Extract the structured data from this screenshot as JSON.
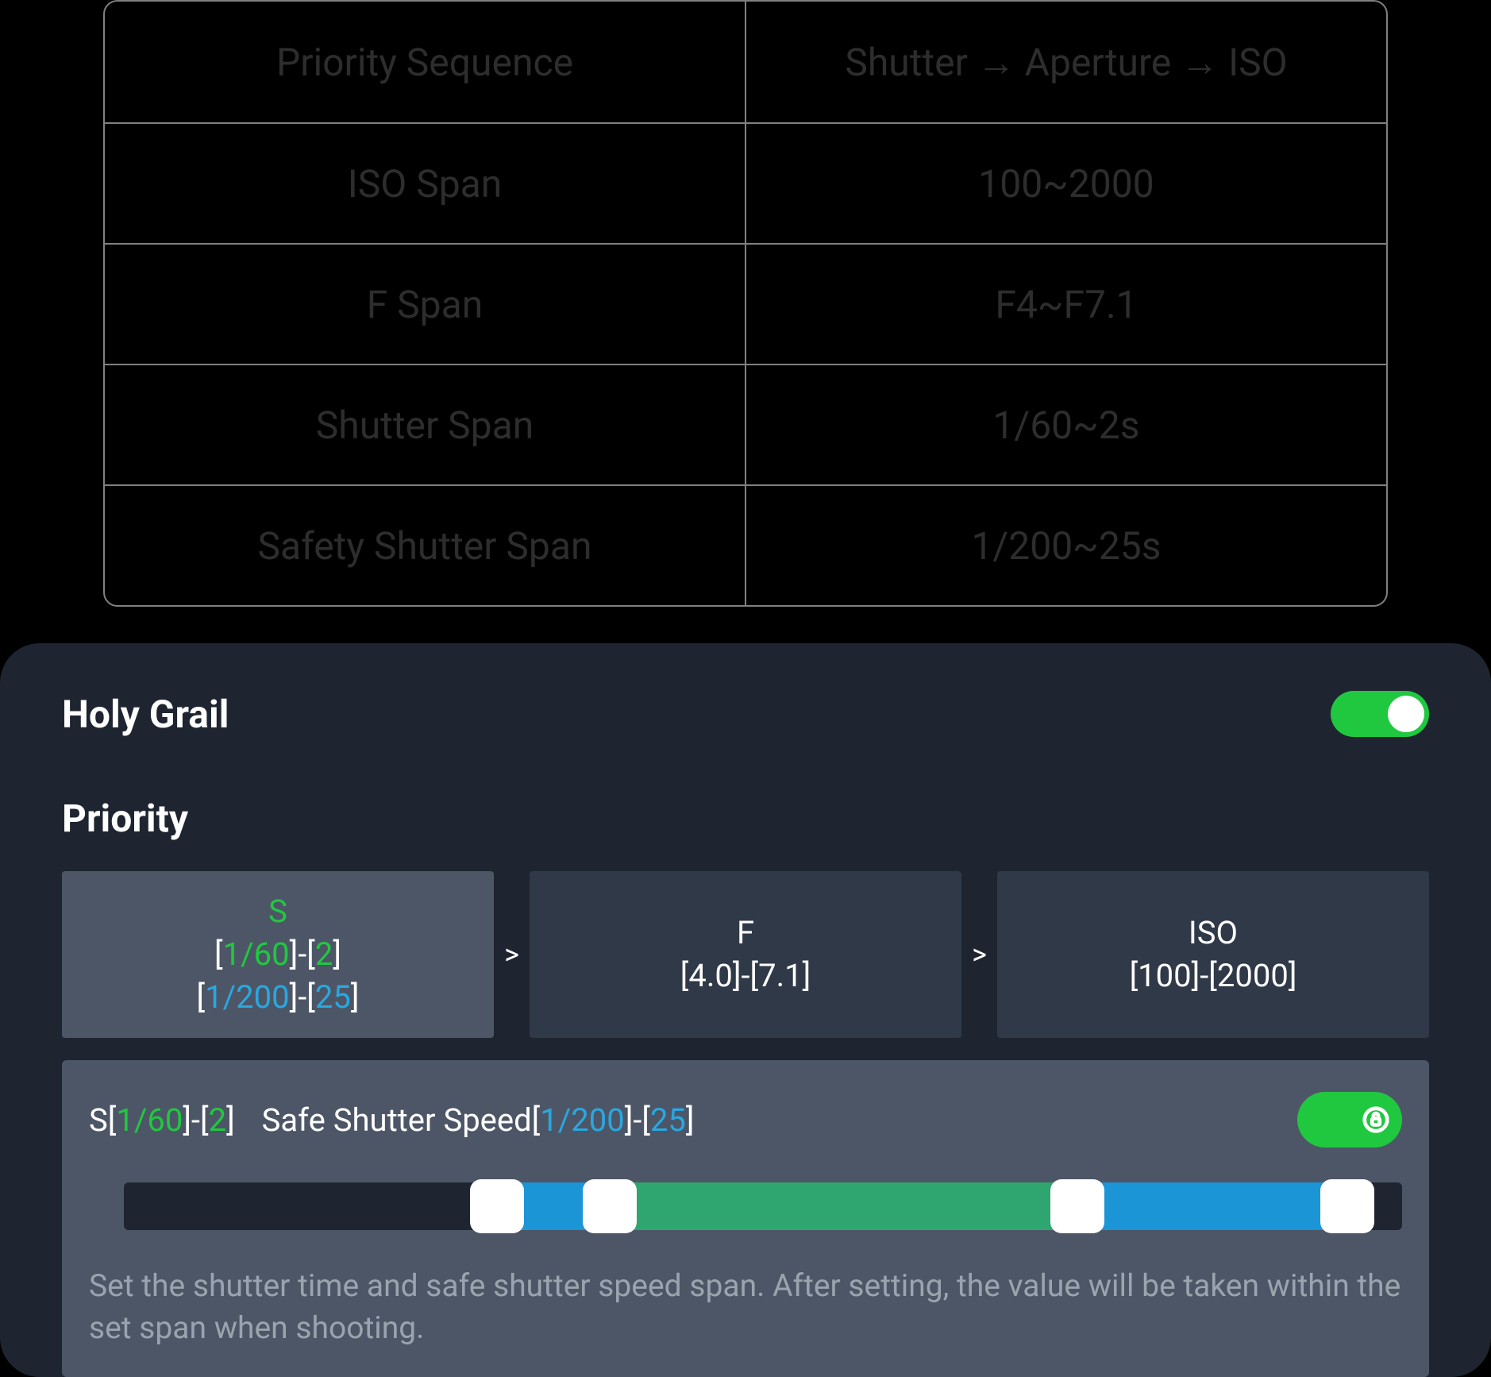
{
  "table": {
    "rows": [
      {
        "label": "Priority Sequence",
        "value": "Shutter → Aperture → ISO"
      },
      {
        "label": "ISO Span",
        "value": "100~2000"
      },
      {
        "label": "F Span",
        "value": "F4~F7.1"
      },
      {
        "label": "Shutter Span",
        "value": "1/60~2s"
      },
      {
        "label": "Safety Shutter Span",
        "value": "1/200~25s"
      }
    ]
  },
  "panel": {
    "title": "Holy Grail",
    "toggle_on": true,
    "priority_label": "Priority",
    "cards": {
      "s": {
        "head": "S",
        "v1a": "1/60",
        "v1b": "2",
        "v2a": "1/200",
        "v2b": "25"
      },
      "f": {
        "head": "F",
        "a": "4.0",
        "b": "7.1"
      },
      "iso": {
        "head": "ISO",
        "a": "100",
        "b": "2000"
      }
    },
    "detail": {
      "s_prefix": "S",
      "s_a": "1/60",
      "s_b": "2",
      "safe_label": "Safe Shutter Speed",
      "safe_a": "1/200",
      "safe_b": "25",
      "help": "Set the shutter time and safe shutter speed span. After setting, the value will be taken within the set span when shooting."
    },
    "chev": ">"
  }
}
